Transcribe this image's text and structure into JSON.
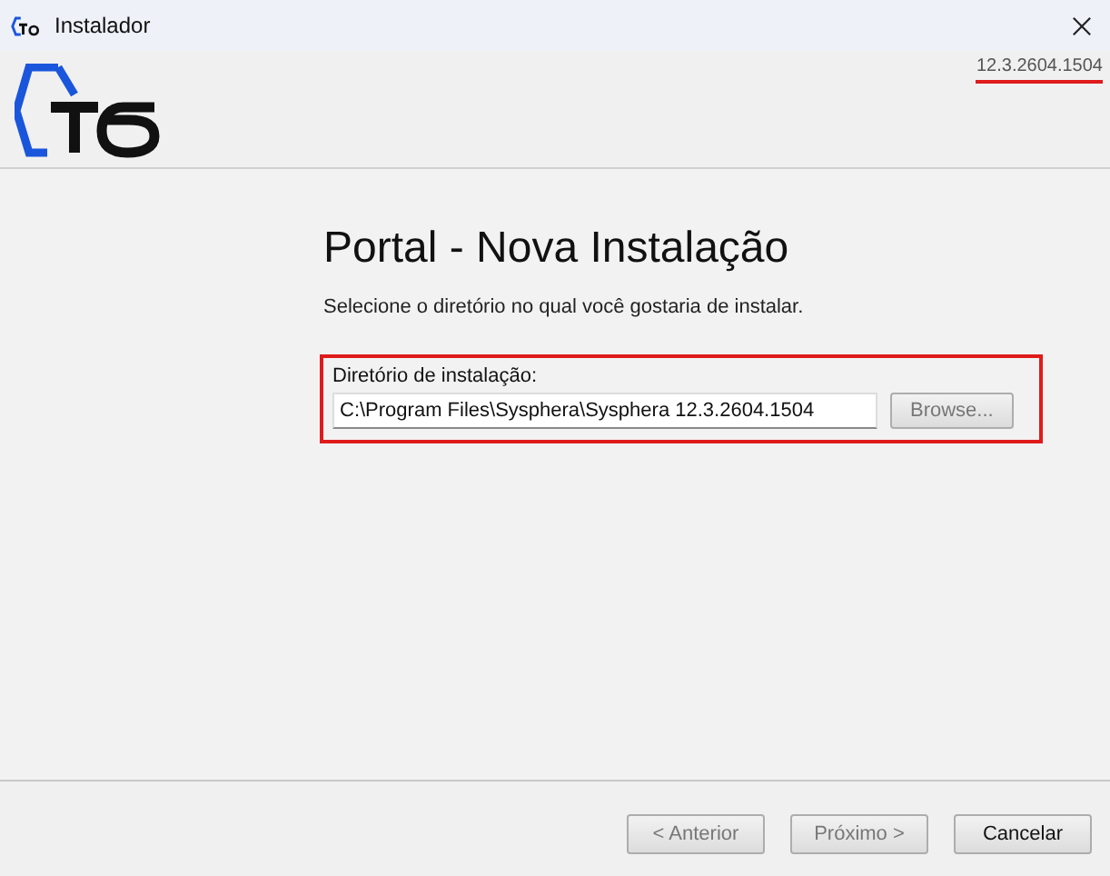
{
  "window": {
    "title": "Instalador"
  },
  "header": {
    "version": {
      "text": "12.3.2604.1504",
      "highlighted": true
    }
  },
  "page": {
    "heading": "Portal - Nova Instalação",
    "instructions": "Selecione o diretório no qual você gostaria de instalar.",
    "directory": {
      "label": "Diretório de instalação:",
      "value": "C:\\Program Files\\Sysphera\\Sysphera 12.3.2604.1504",
      "highlighted": true,
      "browse": {
        "label": "Browse...",
        "disabled": true
      }
    }
  },
  "buttons": [
    {
      "label": "< Anterior",
      "disabled": true
    },
    {
      "label": "Próximo >",
      "disabled": true
    },
    {
      "label": "Cancelar",
      "disabled": false
    }
  ]
}
